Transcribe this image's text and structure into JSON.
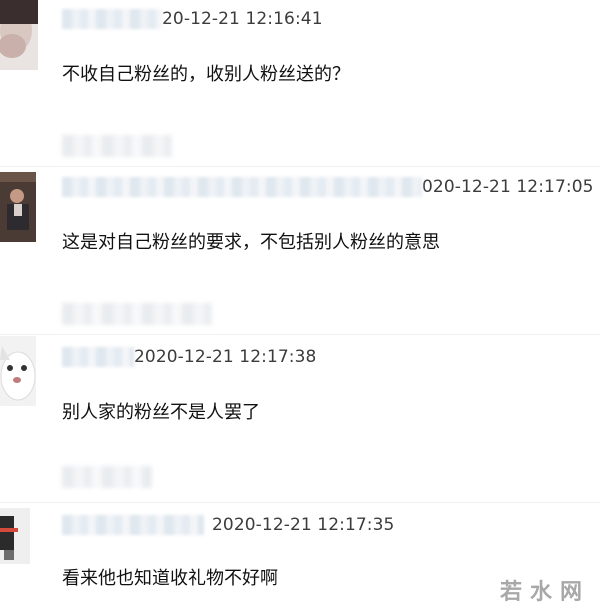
{
  "comments": [
    {
      "time": "20-12-21 12:16:41",
      "text": "不收自己粉丝的，收别人粉丝送的？"
    },
    {
      "time": "020-12-21 12:17:05",
      "text": "这是对自己粉丝的要求，不包括别人粉丝的意思"
    },
    {
      "time": "2020-12-21 12:17:38",
      "text": "别人家的粉丝不是人罢了"
    },
    {
      "time": "2020-12-21 12:17:35",
      "text": "看来他也知道收礼物不好啊"
    }
  ],
  "watermark": "若水网"
}
